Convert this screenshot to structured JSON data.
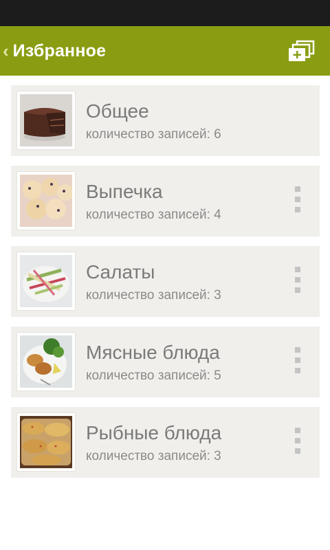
{
  "toolbar": {
    "title": "Избранное",
    "back_icon": "chevron-left-icon",
    "add_icon": "add-collection-icon",
    "background": "#8a9d12"
  },
  "categories": [
    {
      "title": "Общее",
      "count_text": "количество записей: 6",
      "image": "chocolate-cake-image",
      "has_menu": false
    },
    {
      "title": "Выпечка",
      "count_text": "количество записей: 4",
      "image": "buns-image",
      "has_menu": true
    },
    {
      "title": "Салаты",
      "count_text": "количество записей: 3",
      "image": "salad-image",
      "has_menu": true
    },
    {
      "title": "Мясные блюда",
      "count_text": "количество записей: 5",
      "image": "cutlets-plate-image",
      "has_menu": true
    },
    {
      "title": "Рыбные блюда",
      "count_text": "количество записей: 3",
      "image": "fried-fish-image",
      "has_menu": true
    }
  ]
}
